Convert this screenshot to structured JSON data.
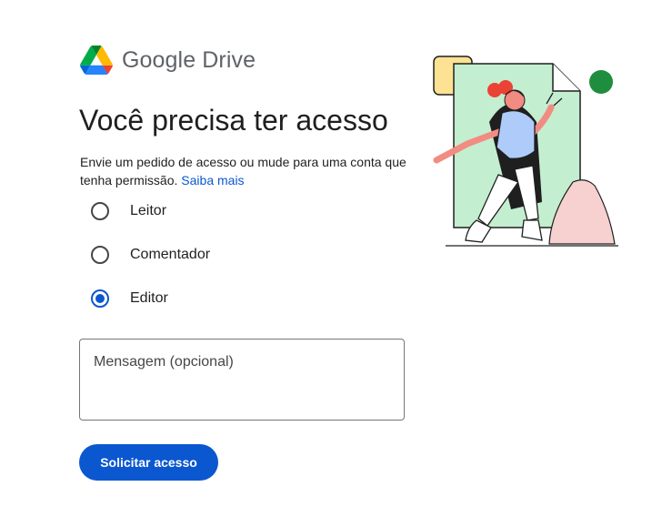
{
  "brand": {
    "name": "Google Drive",
    "logo_icon": "google-drive-logo-icon",
    "logo_colors": [
      "#0066da",
      "#00ac47",
      "#ea4335",
      "#00832d",
      "#2684fc",
      "#ffba00"
    ]
  },
  "page": {
    "title": "Você precisa ter acesso",
    "description": "Envie um pedido de acesso ou mude para uma conta que tenha permissão.",
    "learn_more_link": "Saiba mais"
  },
  "roles": {
    "selected": "Editor",
    "options": [
      {
        "label": "Leitor",
        "checked": false
      },
      {
        "label": "Comentador",
        "checked": false
      },
      {
        "label": "Editor",
        "checked": true
      }
    ]
  },
  "message": {
    "placeholder": "Mensagem (opcional)",
    "value": ""
  },
  "actions": {
    "submit_label": "Solicitar acesso"
  },
  "colors": {
    "accent": "#0b57d0",
    "text": "#1f1f1f",
    "secondary_text": "#5f6368"
  }
}
